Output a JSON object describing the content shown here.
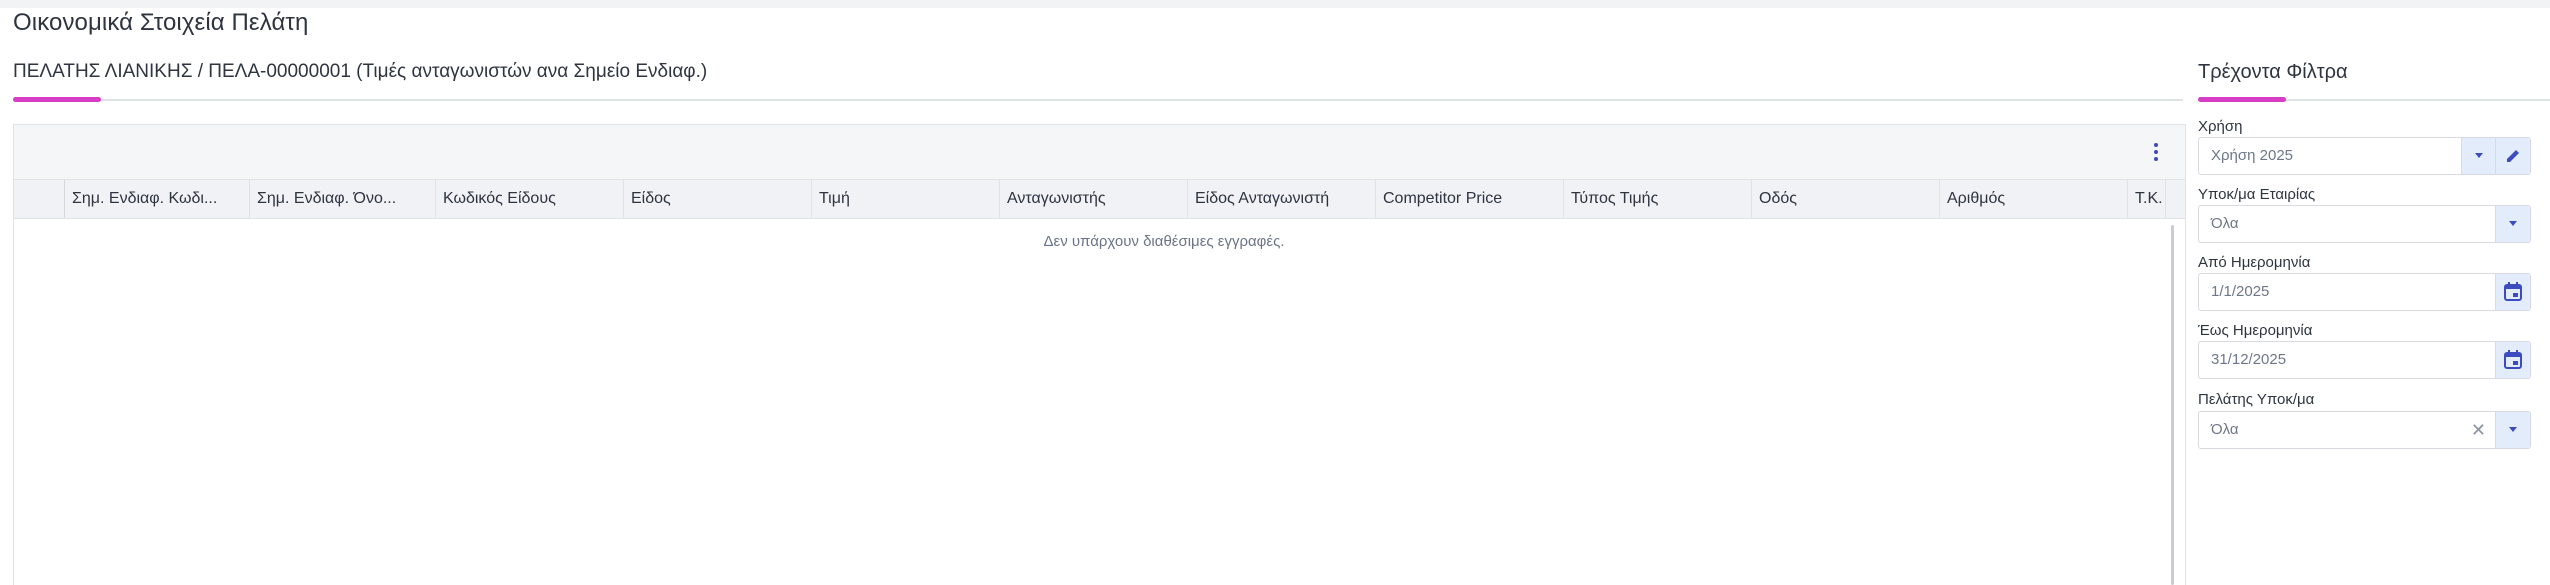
{
  "page": {
    "title": "Οικονομικά Στοιχεία Πελάτη"
  },
  "main": {
    "header": "ΠΕΛΑΤΗΣ ΛΙΑΝΙΚΗΣ / ΠΕΛΑ-00000001 (Τιμές ανταγωνιστών ανα Σημείο Ενδιαφ.)",
    "columns": [
      "Σημ. Ενδιαφ. Κωδι...",
      "Σημ. Ενδιαφ. Όνο...",
      "Κωδικός Είδους",
      "Είδος",
      "Τιμή",
      "Ανταγωνιστής",
      "Είδος Ανταγωνιστή",
      "Competitor Price",
      "Τύπος Τιμής",
      "Οδός",
      "Αριθμός",
      "Τ.Κ."
    ],
    "empty_message": "Δεν υπάρχουν διαθέσιμες εγγραφές."
  },
  "filters": {
    "title": "Τρέχοντα Φίλτρα",
    "year": {
      "label": "Χρήση",
      "value": "Χρήση 2025"
    },
    "company_branch": {
      "label": "Υποκ/μα Εταιρίας",
      "value": "Όλα"
    },
    "from_date": {
      "label": "Από Ημερομηνία",
      "value": "1/1/2025"
    },
    "to_date": {
      "label": "Έως Ημερομηνία",
      "value": "31/12/2025"
    },
    "customer_branch": {
      "label": "Πελάτης Υποκ/μα",
      "value": "Όλα"
    }
  },
  "colors": {
    "accent": "#d63cc4",
    "button_bg": "#e3ecfa",
    "icon": "#3c4cc0"
  },
  "icons": [
    "more-vertical-icon",
    "caret-down-icon",
    "pencil-icon",
    "calendar-icon",
    "close-icon"
  ]
}
